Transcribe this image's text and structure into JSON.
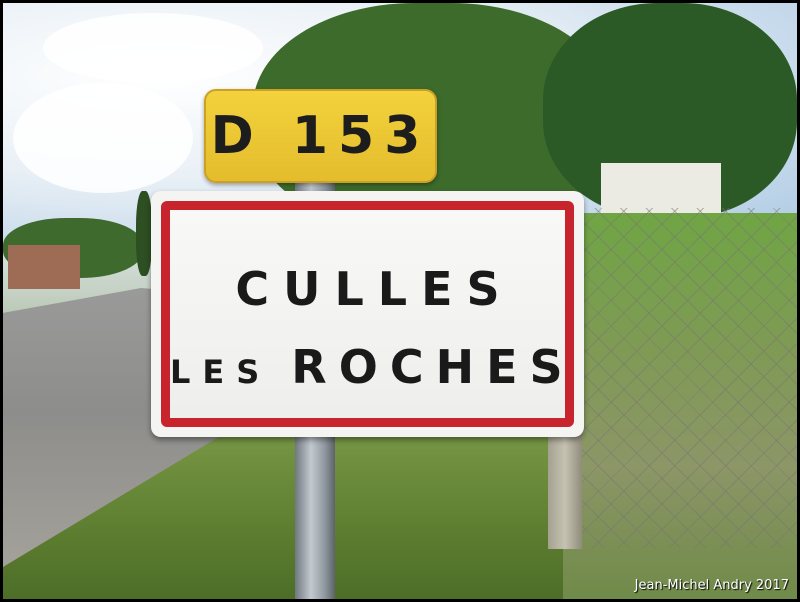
{
  "route_sign": {
    "text": "D 153"
  },
  "town_sign": {
    "line1": "CULLES",
    "line2_prefix": "LES",
    "line2_main": "ROCHES",
    "border_color": "#c8242e"
  },
  "credit": "Jean-Michel Andry 2017"
}
